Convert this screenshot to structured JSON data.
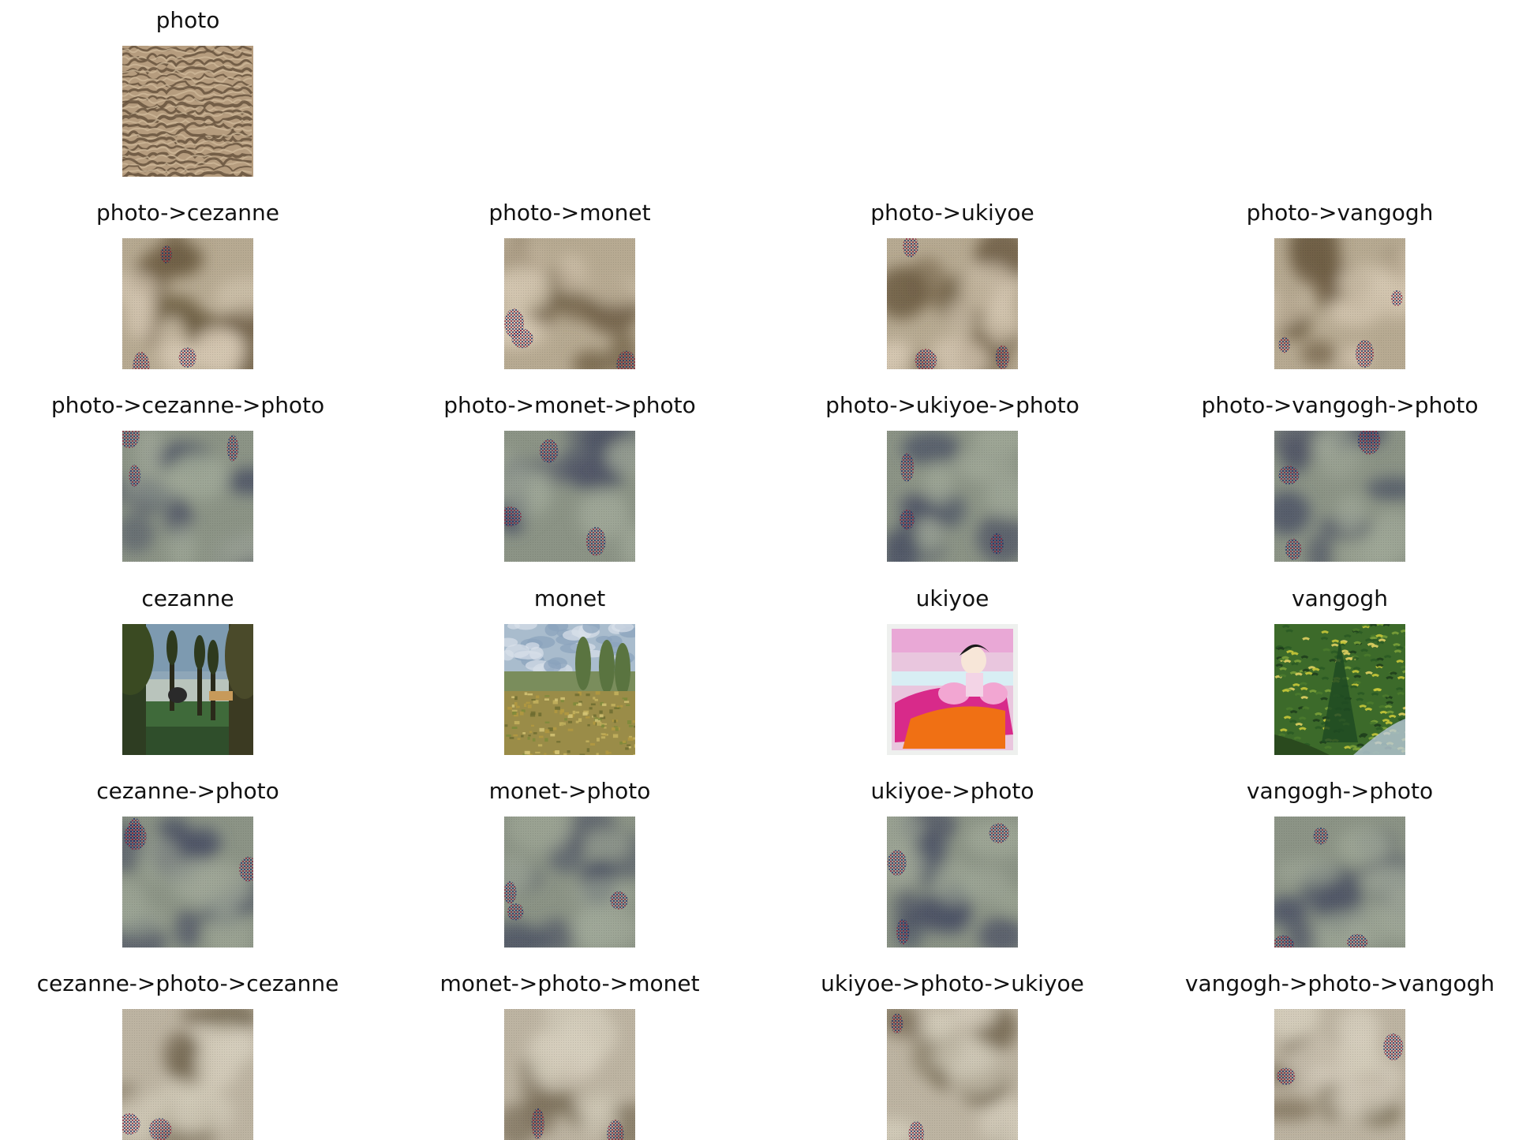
{
  "figure": {
    "rows": [
      {
        "cells": [
          {
            "title": "photo",
            "style": "sand"
          }
        ]
      },
      {
        "cells": [
          {
            "title": "photo->cezanne",
            "style": "tan-blotch"
          },
          {
            "title": "photo->monet",
            "style": "tan-blotch"
          },
          {
            "title": "photo->ukiyoe",
            "style": "tan-blotch"
          },
          {
            "title": "photo->vangogh",
            "style": "tan-blotch"
          }
        ]
      },
      {
        "cells": [
          {
            "title": "photo->cezanne->photo",
            "style": "grey-blotch"
          },
          {
            "title": "photo->monet->photo",
            "style": "grey-blotch"
          },
          {
            "title": "photo->ukiyoe->photo",
            "style": "grey-blotch"
          },
          {
            "title": "photo->vangogh->photo",
            "style": "grey-blotch"
          }
        ]
      },
      {
        "cells": [
          {
            "title": "cezanne",
            "style": "cezanne-painting"
          },
          {
            "title": "monet",
            "style": "monet-painting"
          },
          {
            "title": "ukiyoe",
            "style": "ukiyoe-print"
          },
          {
            "title": "vangogh",
            "style": "vangogh-painting"
          }
        ]
      },
      {
        "cells": [
          {
            "title": "cezanne->photo",
            "style": "grey-blotch"
          },
          {
            "title": "monet->photo",
            "style": "grey-blotch"
          },
          {
            "title": "ukiyoe->photo",
            "style": "grey-blotch"
          },
          {
            "title": "vangogh->photo",
            "style": "grey-blotch"
          }
        ]
      },
      {
        "cells": [
          {
            "title": "cezanne->photo->cezanne",
            "style": "beige-blotch"
          },
          {
            "title": "monet->photo->monet",
            "style": "beige-blotch"
          },
          {
            "title": "ukiyoe->photo->ukiyoe",
            "style": "beige-blotch"
          },
          {
            "title": "vangogh->photo->vangogh",
            "style": "beige-blotch"
          }
        ]
      }
    ]
  }
}
